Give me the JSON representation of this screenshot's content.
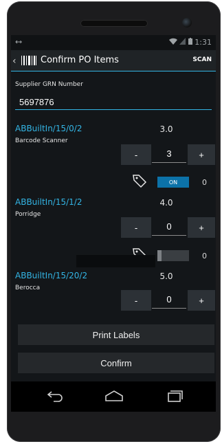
{
  "status_bar": {
    "left_icon": "usb-debug-icon",
    "time": "1:31"
  },
  "action_bar": {
    "title": "Confirm PO Items",
    "scan_label": "SCAN"
  },
  "grn": {
    "label": "Supplier GRN Number",
    "value": "5697876"
  },
  "items": [
    {
      "code": "ABBuiltIn/15/0/2",
      "name": "Barcode Scanner",
      "expected": "3.0",
      "qty": "3",
      "toggle": "ON",
      "count": "0"
    },
    {
      "code": "ABBuiltIn/15/1/2",
      "name": "Porridge",
      "expected": "4.0",
      "qty": "0",
      "toggle": "",
      "count": "0"
    },
    {
      "code": "ABBuiltIn/15/20/2",
      "name": "Berocca",
      "expected": "5.0",
      "qty": "0"
    }
  ],
  "buttons": {
    "minus": "-",
    "plus": "+",
    "print_labels": "Print Labels",
    "confirm": "Confirm"
  },
  "colors": {
    "accent": "#33b5e5",
    "background": "#131619",
    "button": "#2c3136"
  }
}
